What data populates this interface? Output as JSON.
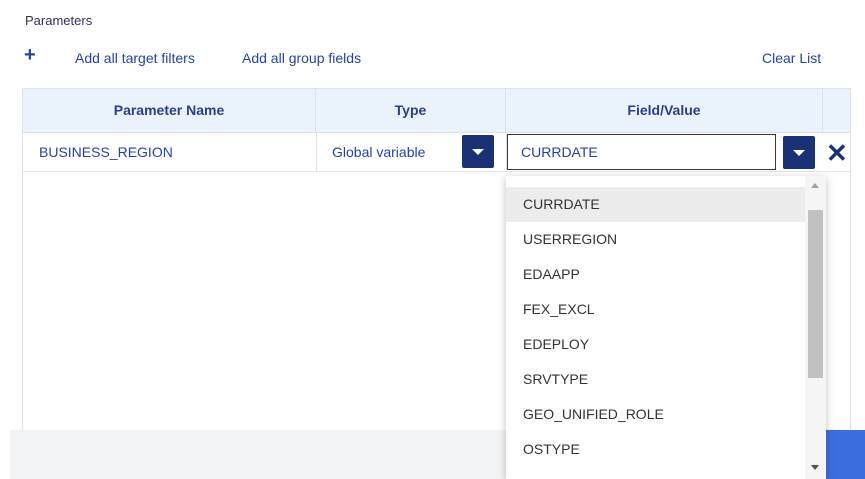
{
  "section": {
    "title": "Parameters"
  },
  "toolbar": {
    "add_icon": "plus-icon",
    "add_target_filters": "Add all target filters",
    "add_group_fields": "Add all group fields",
    "clear_list": "Clear List"
  },
  "table": {
    "headers": [
      "Parameter Name",
      "Type",
      "Field/Value"
    ],
    "row": {
      "parameter_name": "BUSINESS_REGION",
      "type": "Global variable",
      "value": "CURRDATE"
    }
  },
  "dropdown": {
    "selected": "CURRDATE",
    "options": [
      "CURRDATE",
      "USERREGION",
      "EDAAPP",
      "FEX_EXCL",
      "EDEPLOY",
      "SRVTYPE",
      "GEO_UNIFIED_ROLE",
      "OSTYPE"
    ]
  },
  "colors": {
    "header_bg": "#eaf3fb",
    "link": "#2444a3",
    "button": "#1a3275",
    "accent": "#3d6ee0"
  }
}
